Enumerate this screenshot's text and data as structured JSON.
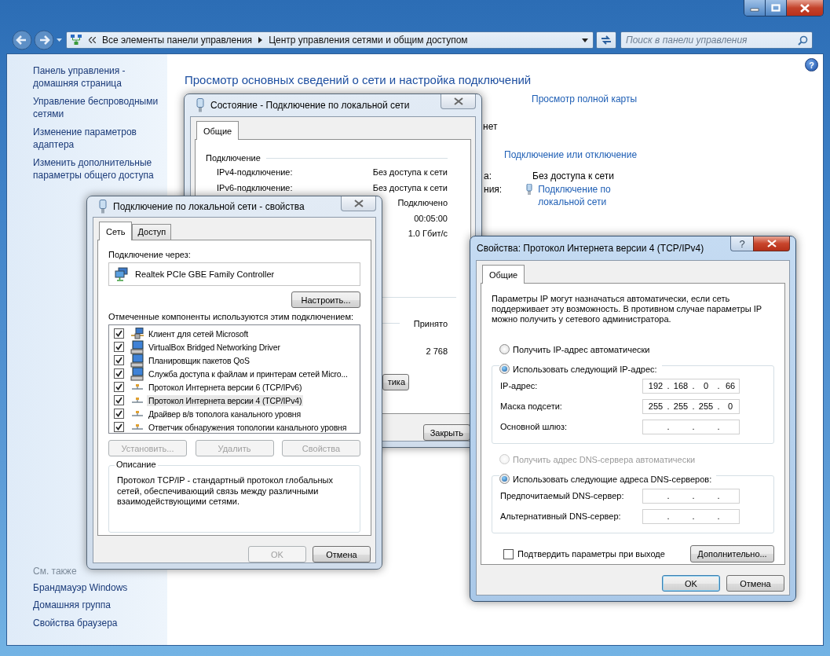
{
  "window": {
    "address_path": [
      "Все элементы панели управления",
      "Центр управления сетями и общим доступом"
    ],
    "search": {
      "placeholder": "Поиск в панели управления"
    },
    "help_glyph": "?"
  },
  "sidebar": {
    "items": [
      "Панель управления - домашняя страница",
      "Управление беспроводными сетями",
      "Изменение параметров адаптера",
      "Изменить дополнительные параметры общего доступа"
    ],
    "see_also_title": "См. также",
    "see_also": [
      "Брандмауэр Windows",
      "Домашняя группа",
      "Свойства браузера"
    ]
  },
  "main": {
    "heading": "Просмотр основных сведений о сети и настройка подключений",
    "map_link": "Просмотр полной карты",
    "network_fragment": "нет",
    "connect_link": "Подключение или отключение",
    "access_fragment": "а:",
    "access_value": "Без доступа к сети",
    "connections_fragment": "ния:",
    "connection_link": "Подключение по локальной сети"
  },
  "status_dialog": {
    "title": "Состояние - Подключение по локальной сети",
    "tabs": [
      {
        "label": "Общие",
        "selected": true
      }
    ],
    "group_title": "Подключение",
    "rows": [
      {
        "label": "IPv4-подключение:",
        "value": "Без доступа к сети"
      },
      {
        "label": "IPv6-подключение:",
        "value": "Без доступа к сети"
      },
      {
        "value": "Подключено"
      },
      {
        "value": "00:05:00"
      },
      {
        "value": "1.0 Гбит/с"
      }
    ],
    "received_title": "Принято",
    "received_value": "2 768",
    "diagnose_button_fragment": "тика",
    "close_button": "Закрыть"
  },
  "props_dialog": {
    "title": "Подключение по локальной сети - свойства",
    "tabs": [
      {
        "label": "Сеть",
        "selected": true
      },
      {
        "label": "Доступ",
        "selected": false
      }
    ],
    "connect_via_label": "Подключение через:",
    "adapter": "Realtek PCIe GBE Family Controller",
    "configure_button": "Настроить...",
    "components_label": "Отмеченные компоненты используются этим подключением:",
    "components": [
      {
        "kind": "client",
        "name": "Клиент для сетей Microsoft",
        "checked": true,
        "selected": false
      },
      {
        "kind": "service",
        "name": "VirtualBox Bridged Networking Driver",
        "checked": true,
        "selected": false
      },
      {
        "kind": "service",
        "name": "Планировщик пакетов QoS",
        "checked": true,
        "selected": false
      },
      {
        "kind": "service",
        "name": "Служба доступа к файлам и принтерам сетей Micro...",
        "checked": true,
        "selected": false
      },
      {
        "kind": "protocol",
        "name": "Протокол Интернета версии 6 (TCP/IPv6)",
        "checked": true,
        "selected": false
      },
      {
        "kind": "protocol",
        "name": "Протокол Интернета версии 4 (TCP/IPv4)",
        "checked": true,
        "selected": true
      },
      {
        "kind": "protocol",
        "name": "Драйвер в/в тополога канального уровня",
        "checked": true,
        "selected": false
      },
      {
        "kind": "protocol",
        "name": "Ответчик обнаружения топологии канального уровня",
        "checked": true,
        "selected": false
      }
    ],
    "buttons": [
      {
        "label": "Установить...",
        "disabled": true
      },
      {
        "label": "Удалить",
        "disabled": true
      },
      {
        "label": "Свойства",
        "disabled": true
      }
    ],
    "description_title": "Описание",
    "description": "Протокол TCP/IP - стандартный протокол глобальных сетей, обеспечивающий связь между различными взаимодействующими сетями.",
    "footer_buttons": [
      {
        "label": "OK",
        "disabled": true
      },
      {
        "label": "Отмена",
        "disabled": false
      }
    ]
  },
  "ipv4_dialog": {
    "title": "Свойства: Протокол Интернета версии 4 (TCP/IPv4)",
    "help_button": "?",
    "tabs": [
      {
        "label": "Общие",
        "selected": true
      }
    ],
    "intro": "Параметры IP могут назначаться автоматически, если сеть поддерживает эту возможность. В противном случае параметры IP можно получить у сетевого администратора.",
    "ip_auto": {
      "label": "Получить IP-адрес автоматически",
      "selected": false,
      "disabled": false
    },
    "ip_manual": {
      "label": "Использовать следующий IP-адрес:",
      "selected": true,
      "disabled": false
    },
    "ip_fields": [
      {
        "label": "IP-адрес:",
        "parts": [
          "192",
          ".",
          "168",
          ".",
          "0",
          ".",
          "66"
        ]
      },
      {
        "label": "Маска подсети:",
        "parts": [
          "255",
          ".",
          "255",
          ".",
          "255",
          ".",
          "0"
        ]
      },
      {
        "label": "Основной шлюз:",
        "parts": [
          ".",
          ".",
          "."
        ]
      }
    ],
    "dns_auto": {
      "label": "Получить адрес DNS-сервера автоматически",
      "selected": false,
      "disabled": true
    },
    "dns_manual": {
      "label": "Использовать следующие адреса DNS-серверов:",
      "selected": true,
      "disabled": false
    },
    "dns_fields": [
      {
        "label": "Предпочитаемый DNS-сервер:",
        "parts": [
          ".",
          ".",
          "."
        ]
      },
      {
        "label": "Альтернативный DNS-сервер:",
        "parts": [
          ".",
          ".",
          "."
        ]
      }
    ],
    "validate": {
      "label": "Подтвердить параметры при выходе",
      "checked": false
    },
    "advanced_button": "Дополнительно...",
    "buttons": [
      {
        "label": "OK",
        "default": true
      },
      {
        "label": "Отмена",
        "default": false
      }
    ]
  }
}
